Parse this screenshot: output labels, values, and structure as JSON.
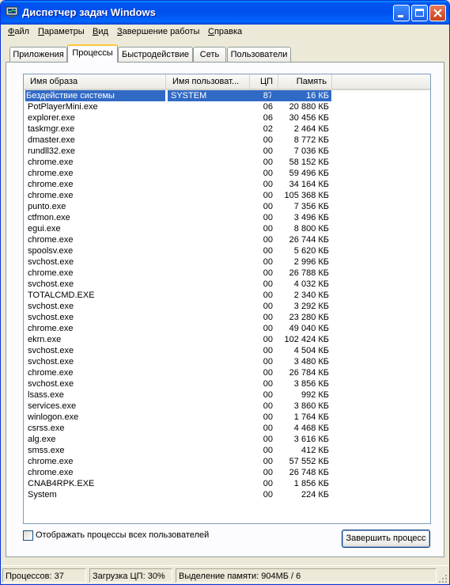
{
  "window": {
    "title": "Диспетчер задач Windows",
    "colors": {
      "titlebar": "#0053ee",
      "selection": "#316ac5",
      "close_button": "#c8421e"
    }
  },
  "menu": [
    "Файл",
    "Параметры",
    "Вид",
    "Завершение работы",
    "Справка"
  ],
  "tabs": [
    "Приложения",
    "Процессы",
    "Быстродействие",
    "Сеть",
    "Пользователи"
  ],
  "active_tab": "Процессы",
  "columns": {
    "name": "Имя образа",
    "user": "Имя пользоват...",
    "cpu": "ЦП",
    "mem": "Память"
  },
  "processes": [
    {
      "name": "Бездействие системы",
      "user": "SYSTEM",
      "cpu": "87",
      "mem": "16 КБ",
      "selected": true
    },
    {
      "name": "PotPlayerMini.exe",
      "user": "",
      "cpu": "06",
      "mem": "20 880 КБ"
    },
    {
      "name": "explorer.exe",
      "user": "",
      "cpu": "06",
      "mem": "30 456 КБ"
    },
    {
      "name": "taskmgr.exe",
      "user": "",
      "cpu": "02",
      "mem": "2 464 КБ"
    },
    {
      "name": "dmaster.exe",
      "user": "",
      "cpu": "00",
      "mem": "8 772 КБ"
    },
    {
      "name": "rundll32.exe",
      "user": "",
      "cpu": "00",
      "mem": "7 036 КБ"
    },
    {
      "name": "chrome.exe",
      "user": "",
      "cpu": "00",
      "mem": "58 152 КБ"
    },
    {
      "name": "chrome.exe",
      "user": "",
      "cpu": "00",
      "mem": "59 496 КБ"
    },
    {
      "name": "chrome.exe",
      "user": "",
      "cpu": "00",
      "mem": "34 164 КБ"
    },
    {
      "name": "chrome.exe",
      "user": "",
      "cpu": "00",
      "mem": "105 368 КБ"
    },
    {
      "name": "punto.exe",
      "user": "",
      "cpu": "00",
      "mem": "7 356 КБ"
    },
    {
      "name": "ctfmon.exe",
      "user": "",
      "cpu": "00",
      "mem": "3 496 КБ"
    },
    {
      "name": "egui.exe",
      "user": "",
      "cpu": "00",
      "mem": "8 800 КБ"
    },
    {
      "name": "chrome.exe",
      "user": "",
      "cpu": "00",
      "mem": "26 744 КБ"
    },
    {
      "name": "spoolsv.exe",
      "user": "",
      "cpu": "00",
      "mem": "5 620 КБ"
    },
    {
      "name": "svchost.exe",
      "user": "",
      "cpu": "00",
      "mem": "2 996 КБ"
    },
    {
      "name": "chrome.exe",
      "user": "",
      "cpu": "00",
      "mem": "26 788 КБ"
    },
    {
      "name": "svchost.exe",
      "user": "",
      "cpu": "00",
      "mem": "4 032 КБ"
    },
    {
      "name": "TOTALCMD.EXE",
      "user": "",
      "cpu": "00",
      "mem": "2 340 КБ"
    },
    {
      "name": "svchost.exe",
      "user": "",
      "cpu": "00",
      "mem": "3 292 КБ"
    },
    {
      "name": "svchost.exe",
      "user": "",
      "cpu": "00",
      "mem": "23 280 КБ"
    },
    {
      "name": "chrome.exe",
      "user": "",
      "cpu": "00",
      "mem": "49 040 КБ"
    },
    {
      "name": "ekrn.exe",
      "user": "",
      "cpu": "00",
      "mem": "102 424 КБ"
    },
    {
      "name": "svchost.exe",
      "user": "",
      "cpu": "00",
      "mem": "4 504 КБ"
    },
    {
      "name": "svchost.exe",
      "user": "",
      "cpu": "00",
      "mem": "3 480 КБ"
    },
    {
      "name": "chrome.exe",
      "user": "",
      "cpu": "00",
      "mem": "26 784 КБ"
    },
    {
      "name": "svchost.exe",
      "user": "",
      "cpu": "00",
      "mem": "3 856 КБ"
    },
    {
      "name": "lsass.exe",
      "user": "",
      "cpu": "00",
      "mem": "992 КБ"
    },
    {
      "name": "services.exe",
      "user": "",
      "cpu": "00",
      "mem": "3 860 КБ"
    },
    {
      "name": "winlogon.exe",
      "user": "",
      "cpu": "00",
      "mem": "1 764 КБ"
    },
    {
      "name": "csrss.exe",
      "user": "",
      "cpu": "00",
      "mem": "4 468 КБ"
    },
    {
      "name": "alg.exe",
      "user": "",
      "cpu": "00",
      "mem": "3 616 КБ"
    },
    {
      "name": "smss.exe",
      "user": "",
      "cpu": "00",
      "mem": "412 КБ"
    },
    {
      "name": "chrome.exe",
      "user": "",
      "cpu": "00",
      "mem": "57 552 КБ"
    },
    {
      "name": "chrome.exe",
      "user": "",
      "cpu": "00",
      "mem": "26 748 КБ"
    },
    {
      "name": "CNAB4RPK.EXE",
      "user": "",
      "cpu": "00",
      "mem": "1 856 КБ"
    },
    {
      "name": "System",
      "user": "",
      "cpu": "00",
      "mem": "224 КБ"
    }
  ],
  "show_all_users_label": "Отображать процессы всех пользователей",
  "show_all_users_checked": false,
  "end_process_label": "Завершить процесс",
  "status": {
    "processes": "Процессов: 37",
    "cpu": "Загрузка ЦП: 30%",
    "memory": "Выделение памяти: 904МБ / 6"
  }
}
